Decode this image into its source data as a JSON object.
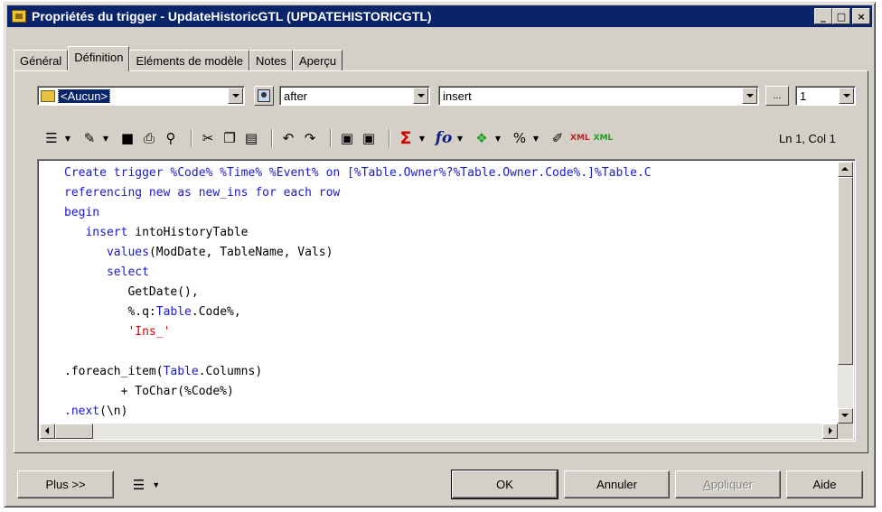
{
  "window": {
    "title": "Propriétés du trigger - UpdateHistoricGTL (UPDATEHISTORICGTL)",
    "controls": {
      "minimize": "_",
      "maximize": "□",
      "close": "×"
    }
  },
  "tabs": [
    {
      "label": "Général",
      "active": false
    },
    {
      "label": "Définition",
      "active": true
    },
    {
      "label": "Eléments de modèle",
      "active": false
    },
    {
      "label": "Notes",
      "active": false
    },
    {
      "label": "Aperçu",
      "active": false
    }
  ],
  "definition": {
    "template_select": "<Aucun>",
    "time_select": "after",
    "event_select": "insert",
    "ellipsis_label": "...",
    "order_select": "1"
  },
  "toolbar": {
    "icons": [
      "list-icon",
      "edit-icon",
      "save-icon",
      "print-icon",
      "find-icon",
      "cut-icon",
      "copy-icon",
      "paste-icon",
      "undo-icon",
      "redo-icon",
      "insert-file-icon",
      "export-file-icon",
      "sigma-icon",
      "function-icon",
      "tree-icon",
      "percent-icon",
      "pencil-icon",
      "xml-red-icon",
      "xml-green-icon"
    ],
    "position": "Ln 1, Col 1"
  },
  "code_lines": [
    [
      {
        "t": "Create trigger %Code% %Time% %Event% on [%Table.Owner%?%Table.Owner.Code%.]%Table.C",
        "c": "blue"
      }
    ],
    [
      {
        "t": "referencing new as new_ins for each row",
        "c": "blue"
      }
    ],
    [
      {
        "t": "begin",
        "c": "blue"
      }
    ],
    [
      {
        "t": "   ",
        "c": "black"
      },
      {
        "t": "insert",
        "c": "blue"
      },
      {
        "t": " intoHistoryTable",
        "c": "black"
      }
    ],
    [
      {
        "t": "      ",
        "c": "black"
      },
      {
        "t": "values",
        "c": "blue"
      },
      {
        "t": "(ModDate, TableName, Vals)",
        "c": "black"
      }
    ],
    [
      {
        "t": "      ",
        "c": "black"
      },
      {
        "t": "select",
        "c": "blue"
      }
    ],
    [
      {
        "t": "         GetDate(),",
        "c": "black"
      }
    ],
    [
      {
        "t": "         %.q:",
        "c": "black"
      },
      {
        "t": "Table",
        "c": "blue"
      },
      {
        "t": ".Code%,",
        "c": "black"
      }
    ],
    [
      {
        "t": "         ",
        "c": "black"
      },
      {
        "t": "'Ins_'",
        "c": "red"
      }
    ],
    [
      {
        "t": "",
        "c": "black"
      }
    ],
    [
      {
        "t": ".foreach_item(",
        "c": "black"
      },
      {
        "t": "Table",
        "c": "blue"
      },
      {
        "t": ".Columns)",
        "c": "black"
      }
    ],
    [
      {
        "t": "        + ToChar(%Code%)",
        "c": "black"
      }
    ],
    [
      {
        "t": ".next",
        "c": "blue"
      },
      {
        "t": "(\\n)",
        "c": "black"
      }
    ]
  ],
  "buttons": {
    "more": "Plus >>",
    "ok": "OK",
    "cancel": "Annuler",
    "apply_prefix": "",
    "apply_underline": "A",
    "apply_rest": "ppliquer",
    "help": "Aide"
  }
}
